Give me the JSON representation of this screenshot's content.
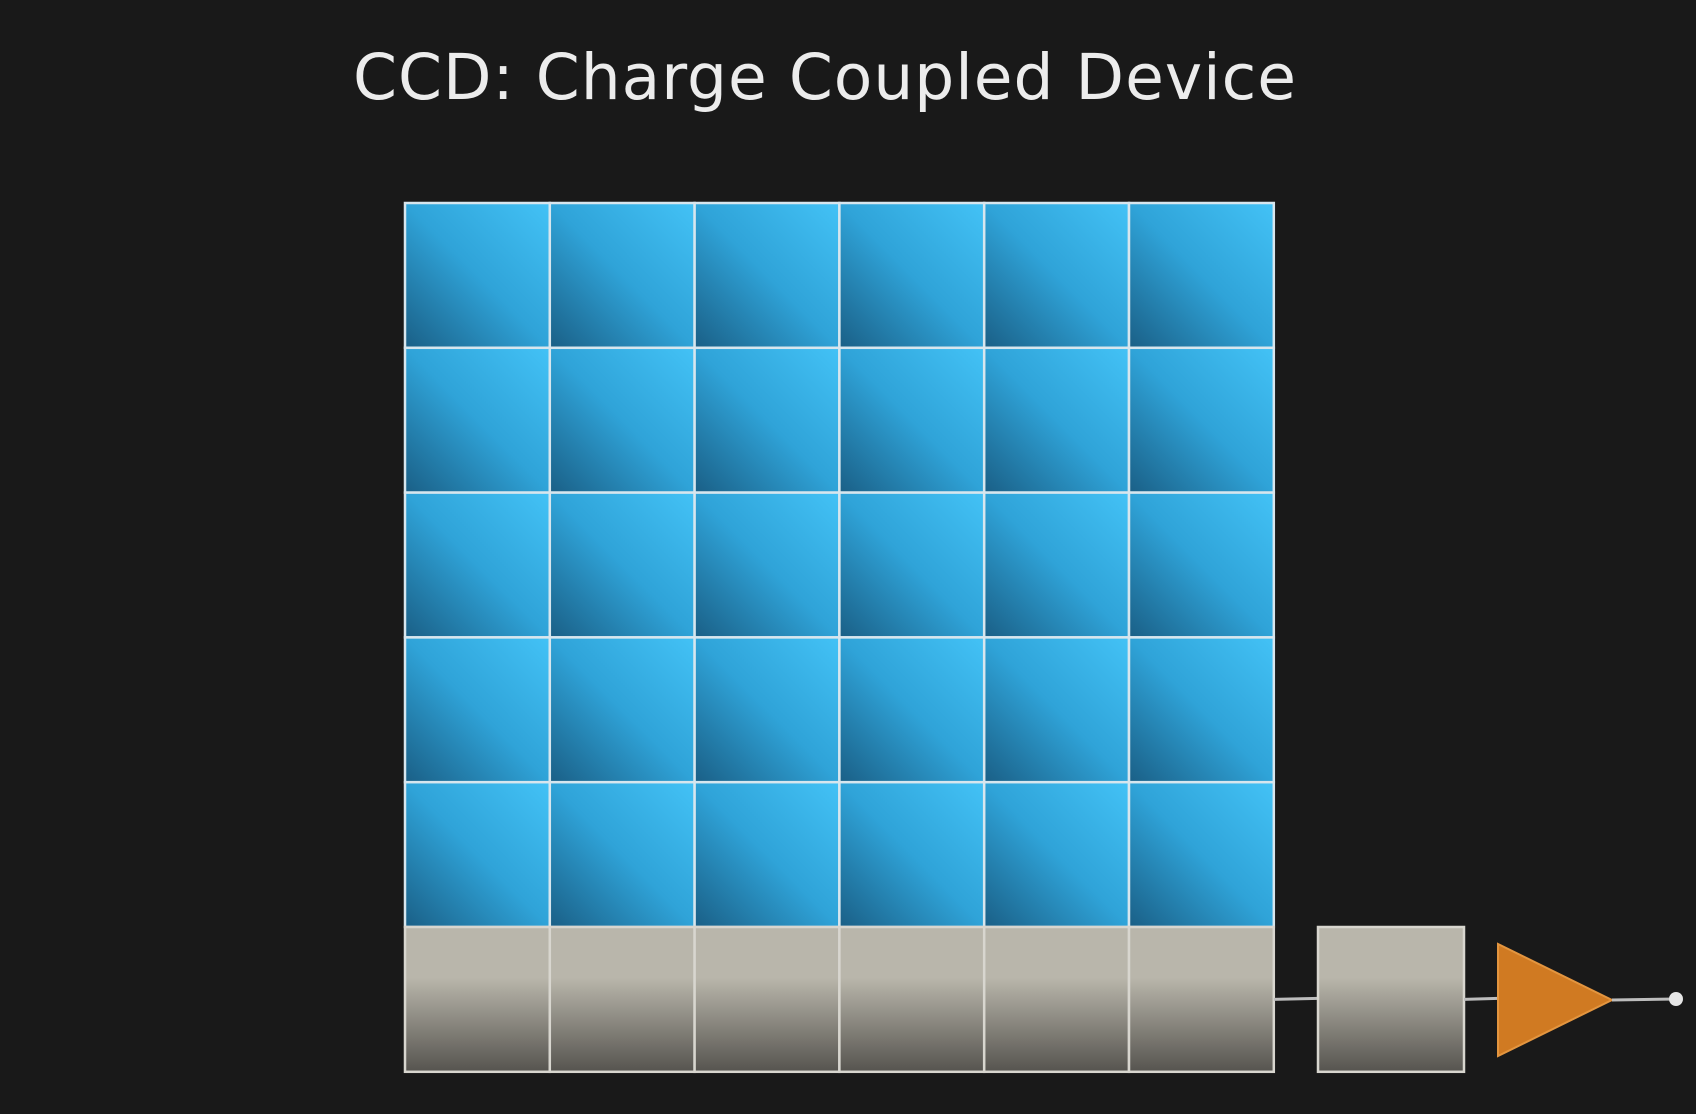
{
  "slide": {
    "title": "CCD: Charge Coupled Device"
  },
  "sensor": {
    "pixel_rows": 5,
    "pixel_cols": 6,
    "readout_register_cells": 6,
    "output_node_cells": 1,
    "colors": {
      "pixel_light": "#43c2f6",
      "pixel_mid": "#2fa3d8",
      "pixel_dark": "#1a5f86",
      "grid_line": "#d7e6ee",
      "register_light": "#b9b6ab",
      "register_dark": "#56544f",
      "amplifier": "#d07a22",
      "wire": "#bdbdbd",
      "background": "#191919"
    },
    "icons": {
      "amplifier": "amplifier-triangle-icon",
      "output": "output-terminal-icon"
    }
  }
}
